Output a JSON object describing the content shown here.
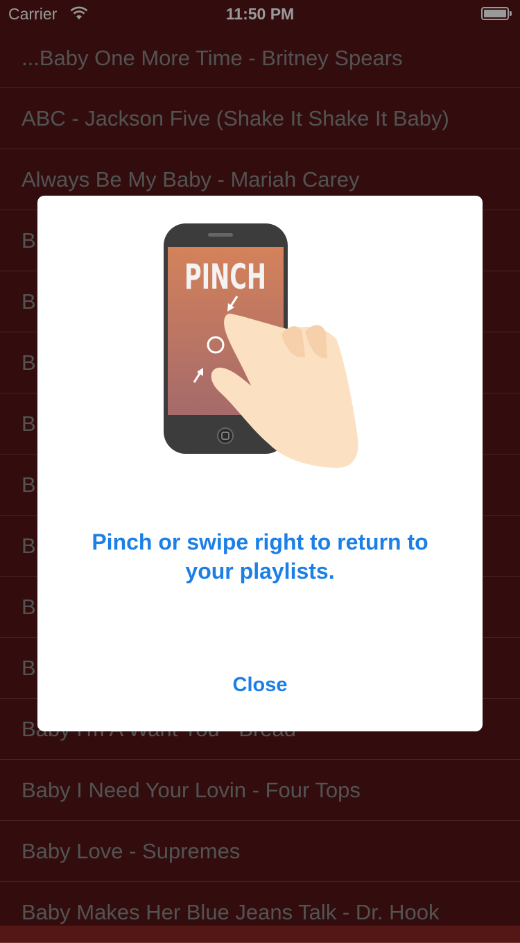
{
  "status_bar": {
    "carrier": "Carrier",
    "time": "11:50 PM"
  },
  "songs": [
    "...Baby One More Time - Britney Spears",
    "ABC - Jackson Five (Shake It Shake It Baby)",
    "Always Be My Baby - Mariah Carey",
    "B",
    "B",
    "B",
    "B",
    "B",
    "B",
    "B",
    "B",
    "Baby I'm A Want You - Bread",
    "Baby I Need Your Lovin - Four Tops",
    "Baby Love - Supremes",
    "Baby Makes Her Blue Jeans Talk - Dr. Hook"
  ],
  "modal": {
    "illustration_text": "PINCH",
    "message": "Pinch or swipe right to return to your playlists.",
    "close_label": "Close"
  },
  "colors": {
    "background": "#551616",
    "accent": "#1b7fe6",
    "list_text": "#8b8b8b"
  }
}
